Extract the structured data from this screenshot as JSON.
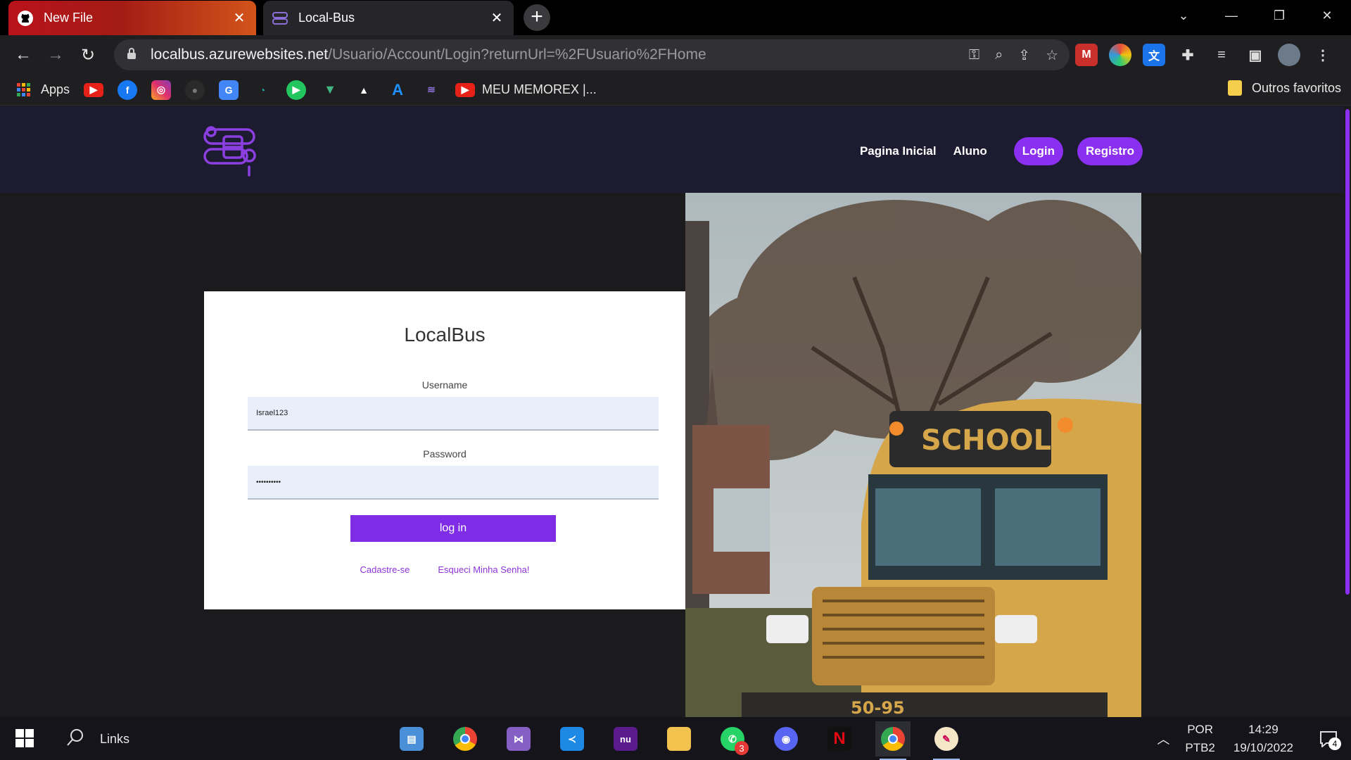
{
  "browser": {
    "tabs": [
      {
        "title": "New File",
        "icon": "github-icon",
        "active": false
      },
      {
        "title": "Local-Bus",
        "icon": "localbus-favicon",
        "active": true
      }
    ],
    "url_host": "localbus.azurewebsites.net",
    "url_path": "/Usuario/Account/Login?returnUrl=%2FUsuario%2FHome"
  },
  "bookmarks": {
    "apps_label": "Apps",
    "memorex_label": "MEU MEMOREX |...",
    "other_label": "Outros favoritos"
  },
  "site": {
    "nav": {
      "home": "Pagina Inicial",
      "student": "Aluno",
      "login": "Login",
      "register": "Registro"
    },
    "accent": "#8b2ff0"
  },
  "login": {
    "brand": "LocalBus",
    "username_label": "Username",
    "username_value": "Israel123",
    "password_label": "Password",
    "password_value": "••••••••••",
    "submit_label": "log in",
    "signup_link": "Cadastre-se",
    "forgot_link": "Esqueci Minha Senha!"
  },
  "hero": {
    "sign_text": "SCHOOL BUS",
    "plate_text": "50-95"
  },
  "taskbar": {
    "search_label": "Links",
    "whatsapp_badge": "3",
    "lang_top": "POR",
    "lang_bottom": "PTB2",
    "time": "14:29",
    "date": "19/10/2022",
    "notif_count": "4"
  }
}
